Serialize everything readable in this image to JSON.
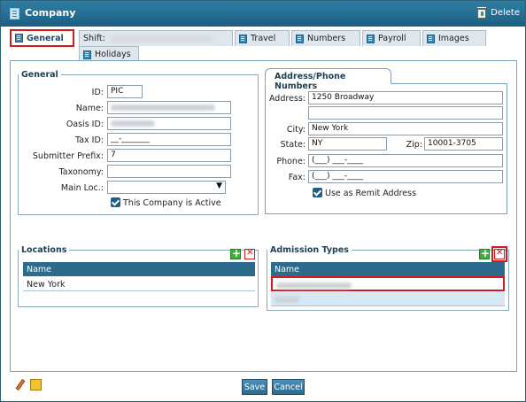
{
  "window": {
    "title": "Company",
    "delete_label": "Delete"
  },
  "tabs": {
    "general": "General",
    "shift": "Shift:",
    "travel": "Travel",
    "numbers": "Numbers",
    "payroll": "Payroll",
    "images": "Images",
    "holidays": "Holidays"
  },
  "general": {
    "legend": "General",
    "id_label": "ID:",
    "id_value": "PIC",
    "name_label": "Name:",
    "name_value": "",
    "oasis_label": "Oasis ID:",
    "oasis_value": "",
    "tax_label": "Tax ID:",
    "tax_value": "__-_______",
    "submitter_label": "Submitter Prefix:",
    "submitter_value": "7",
    "taxonomy_label": "Taxonomy:",
    "taxonomy_value": "",
    "mainloc_label": "Main Loc.:",
    "mainloc_value": "",
    "active_label": "This Company is Active"
  },
  "address": {
    "tab_label": "Address/Phone Numbers",
    "address_label": "Address:",
    "address1": "1250 Broadway",
    "address2": "",
    "city_label": "City:",
    "city": "New York",
    "state_label": "State:",
    "state": "NY",
    "zip_label": "Zip:",
    "zip": "10001-3705",
    "phone_label": "Phone:",
    "phone": "(___) ___-____",
    "fax_label": "Fax:",
    "fax": "(___) ___-____",
    "remit_label": "Use as Remit Address"
  },
  "locations": {
    "legend": "Locations",
    "col_name": "Name",
    "rows": [
      "New York"
    ]
  },
  "admission": {
    "legend": "Admission Types",
    "col_name": "Name"
  },
  "footer": {
    "save": "Save",
    "cancel": "Cancel"
  }
}
